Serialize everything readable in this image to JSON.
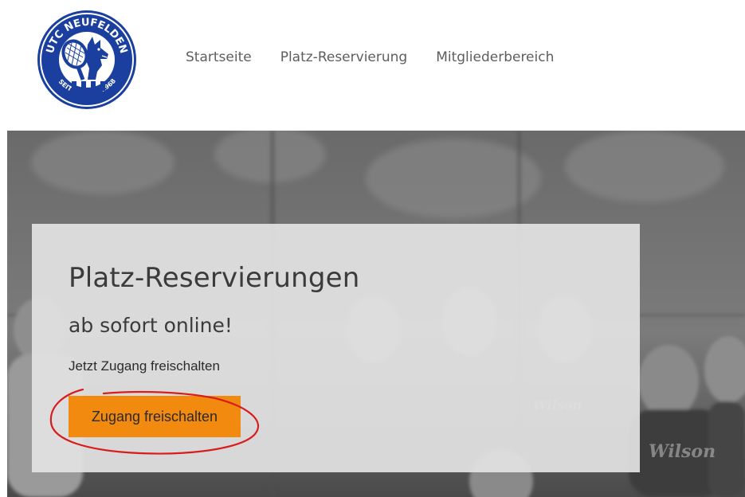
{
  "logo": {
    "top_text": "UTC NEUFELDEN",
    "bottom_left": "SEIT",
    "bottom_right": "1968"
  },
  "nav": {
    "items": [
      {
        "label": "Startseite"
      },
      {
        "label": "Platz-Reservierung"
      },
      {
        "label": "Mitgliederbereich"
      }
    ]
  },
  "hero": {
    "title": "Platz-Reservierungen",
    "subtitle": "ab sofort online!",
    "text": "Jetzt Zugang freischalten",
    "button_label": "Zugang freischalten"
  },
  "colors": {
    "accent": "#f28a0f",
    "logo_blue": "#1a3f9e",
    "annotation_red": "#d91c1c",
    "nav_text": "#5e5e5e"
  }
}
